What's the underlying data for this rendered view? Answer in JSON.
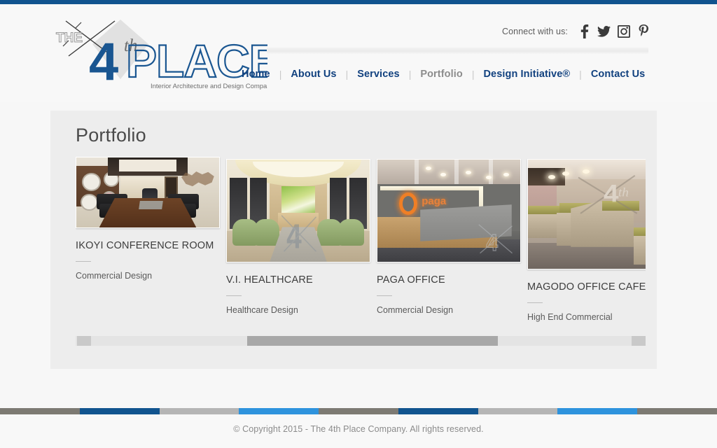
{
  "theme": {
    "top_bar_color": "#11548f",
    "nav_link_color": "#11417f",
    "nav_active_color": "#8c8c8c",
    "page_bg": "#f7f7f7",
    "panel_bg": "#ededed",
    "heading_color": "#4a4a4a",
    "footer_text_color": "#8b8b8b"
  },
  "header": {
    "logo": {
      "the_text": "THE",
      "number": "4",
      "ordinal": "th",
      "word": "PLACE",
      "tagline": "Interior Architecture and Design Company"
    },
    "connect": {
      "label": "Connect with us:",
      "icons": [
        {
          "name": "facebook-icon",
          "glyph": "facebook"
        },
        {
          "name": "twitter-icon",
          "glyph": "twitter"
        },
        {
          "name": "instagram-icon",
          "glyph": "instagram"
        },
        {
          "name": "pinterest-icon",
          "glyph": "pinterest"
        }
      ]
    },
    "nav": {
      "divider": "|",
      "items": [
        {
          "label": "Home",
          "active": false
        },
        {
          "label": "About Us",
          "active": false
        },
        {
          "label": "Services",
          "active": false
        },
        {
          "label": "Portfolio",
          "active": true
        },
        {
          "label": "Design Initiative®",
          "active": false
        },
        {
          "label": "Contact Us",
          "active": false
        }
      ]
    }
  },
  "main": {
    "title": "Portfolio",
    "cards": [
      {
        "title": "IKOYI CONFERENCE ROOM",
        "subtitle": "Commercial Design",
        "image_alt": "ikoyi-conference-room-thumbnail"
      },
      {
        "title": "V.I. HEALTHCARE",
        "subtitle": "Healthcare Design",
        "image_alt": "vi-healthcare-thumbnail"
      },
      {
        "title": "PAGA OFFICE",
        "subtitle": "Commercial Design",
        "image_alt": "paga-office-thumbnail",
        "sign_text": "paga"
      },
      {
        "title": "MAGODO OFFICE CAFETE",
        "subtitle": "High End Commercial",
        "image_alt": "magodo-office-cafeteria-thumbnail"
      }
    ],
    "scrollbar": {
      "thumb_position_percent": 54,
      "thumb_width_percent": 44
    }
  },
  "footer": {
    "stripes": [
      "#7d7a73",
      "#11548f",
      "#b5b5b5",
      "#2e93dd",
      "#7d7a73",
      "#11548f",
      "#b5b5b5",
      "#2e93dd",
      "#7d7a73"
    ],
    "copyright": "© Copyright 2015 - The 4th Place Company. All rights reserved."
  }
}
